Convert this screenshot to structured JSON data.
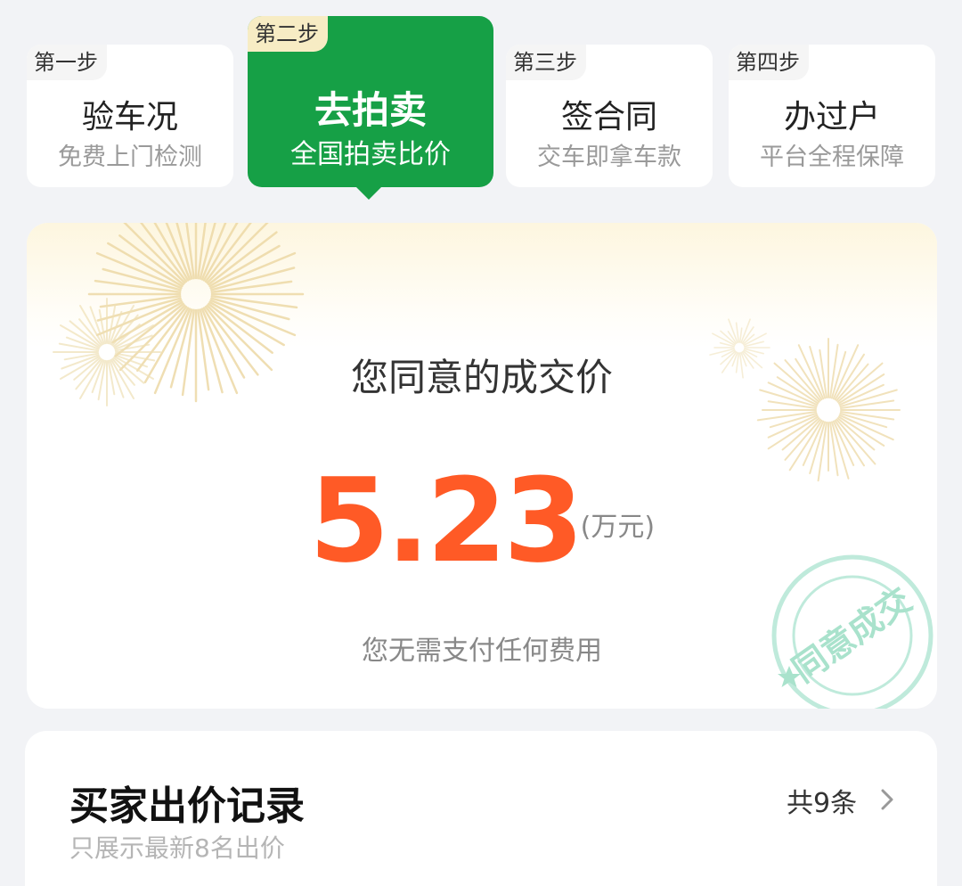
{
  "steps": [
    {
      "tag": "第一步",
      "title": "验车况",
      "sub": "免费上门检测"
    },
    {
      "tag": "第二步",
      "title": "去拍卖",
      "sub": "全国拍卖比价"
    },
    {
      "tag": "第三步",
      "title": "签合同",
      "sub": "交车即拿车款"
    },
    {
      "tag": "第四步",
      "title": "办过户",
      "sub": "平台全程保障"
    }
  ],
  "active_step_index": 1,
  "price_card": {
    "label": "您同意的成交价",
    "value": "5.23",
    "unit": "(万元)",
    "note": "您无需支付任何费用",
    "stamp_text": "同意成交"
  },
  "bid_record": {
    "title": "买家出价记录",
    "subtitle": "只展示最新8名出价",
    "count": "共9条"
  },
  "colors": {
    "accent_green": "#16a046",
    "price_orange": "#ff5a26",
    "stamp_teal": "#7fd8b8",
    "tag_highlight": "#f7ecc4"
  },
  "icons": {
    "chevron": "chevron-right-icon",
    "stamp_star": "star-icon",
    "fireworks": "fireworks-decoration"
  }
}
